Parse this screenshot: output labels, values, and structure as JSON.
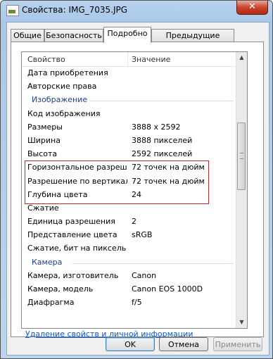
{
  "window": {
    "title": "Свойства: IMG_7035.JPG",
    "close_label": "✕"
  },
  "tabs": [
    {
      "label": "Общие"
    },
    {
      "label": "Безопасность"
    },
    {
      "label": "Подробно"
    },
    {
      "label": "Предыдущие версии"
    }
  ],
  "list": {
    "header": {
      "property": "Свойство",
      "value": "Значение"
    },
    "rows": [
      {
        "name": "Дата приобретения",
        "value": ""
      },
      {
        "name": "Авторские права",
        "value": ""
      },
      {
        "group": "Изображение"
      },
      {
        "name": "Код изображения",
        "value": ""
      },
      {
        "name": "Размеры",
        "value": "3888 x 2592"
      },
      {
        "name": "Ширина",
        "value": "3888 пикселей"
      },
      {
        "name": "Высота",
        "value": "2592 пикселей"
      },
      {
        "name": "Горизонтальное разреше...",
        "value": "72 точек на дюйм"
      },
      {
        "name": "Разрешение по вертикали",
        "value": "72 точек на дюйм"
      },
      {
        "name": "Глубина цвета",
        "value": "24"
      },
      {
        "name": "Сжатие",
        "value": ""
      },
      {
        "name": "Единица разрешения",
        "value": "2"
      },
      {
        "name": "Представление цвета",
        "value": "sRGB"
      },
      {
        "name": "Сжатие, бит на пиксель",
        "value": ""
      },
      {
        "group": "Камера"
      },
      {
        "name": "Камера, изготовитель",
        "value": "Canon"
      },
      {
        "name": "Камера, модель",
        "value": "Canon EOS 1000D"
      },
      {
        "name": "Диафрагма",
        "value": "f/5"
      }
    ]
  },
  "remove_link": "Удаление свойств и личной информации",
  "buttons": {
    "ok": "OK",
    "cancel": "Отмена",
    "apply": "Применить"
  },
  "colors": {
    "highlight_border": "#c0282d",
    "group_title": "#1e3f8a",
    "link": "#0b57d0"
  }
}
